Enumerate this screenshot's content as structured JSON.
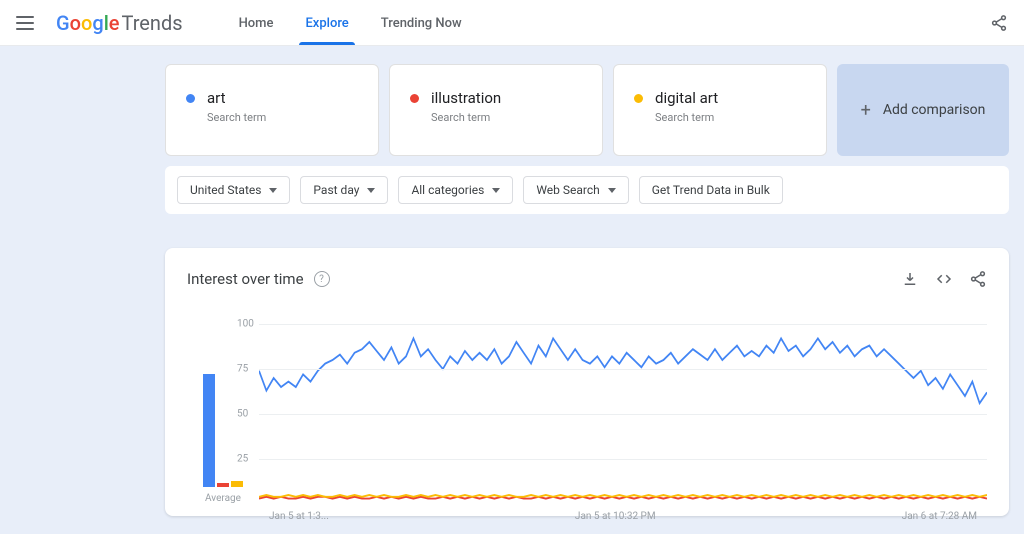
{
  "header": {
    "logo_google": "Google",
    "logo_trends": "Trends",
    "nav": [
      {
        "label": "Home",
        "active": false
      },
      {
        "label": "Explore",
        "active": true
      },
      {
        "label": "Trending Now",
        "active": false
      }
    ]
  },
  "terms": [
    {
      "name": "art",
      "sub": "Search term",
      "color": "#4285F4"
    },
    {
      "name": "illustration",
      "sub": "Search term",
      "color": "#EA4335"
    },
    {
      "name": "digital art",
      "sub": "Search term",
      "color": "#FBBC05"
    }
  ],
  "add_compare_label": "Add comparison",
  "filters": {
    "geo": "United States",
    "time": "Past day",
    "category": "All categories",
    "search_type": "Web Search",
    "bulk": "Get Trend Data in Bulk"
  },
  "chart": {
    "title": "Interest over time",
    "avg_label": "Average",
    "x_labels": [
      "Jan 5 at 1:3...",
      "Jan 5 at 10:32 PM",
      "Jan 6 at 7:28 AM"
    ]
  },
  "chart_data": {
    "type": "line",
    "ylabel": "",
    "ylim": [
      0,
      100
    ],
    "yticks": [
      25,
      50,
      75,
      100
    ],
    "x_labels": [
      "Jan 5 at 1:3...",
      "Jan 5 at 10:32 PM",
      "Jan 6 at 7:28 AM"
    ],
    "averages": {
      "art": 81,
      "illustration": 3,
      "digital art": 4
    },
    "series": [
      {
        "name": "art",
        "color": "#4285F4",
        "values": [
          74,
          63,
          70,
          65,
          68,
          65,
          72,
          68,
          74,
          78,
          80,
          83,
          78,
          84,
          86,
          90,
          85,
          80,
          87,
          78,
          82,
          92,
          82,
          86,
          80,
          75,
          82,
          78,
          85,
          80,
          84,
          80,
          86,
          78,
          82,
          90,
          84,
          78,
          88,
          82,
          92,
          86,
          80,
          86,
          80,
          78,
          82,
          76,
          82,
          78,
          84,
          80,
          76,
          82,
          78,
          80,
          84,
          78,
          82,
          86,
          83,
          80,
          86,
          80,
          84,
          88,
          82,
          85,
          82,
          88,
          84,
          92,
          85,
          88,
          82,
          86,
          92,
          86,
          90,
          84,
          88,
          82,
          86,
          88,
          82,
          86,
          82,
          78,
          74,
          70,
          74,
          66,
          70,
          64,
          72,
          66,
          60,
          68,
          56,
          62
        ]
      },
      {
        "name": "illustration",
        "color": "#EA4335",
        "values": [
          3,
          4,
          3,
          4,
          3,
          3,
          4,
          3,
          4,
          4,
          3,
          4,
          3,
          4,
          3,
          3,
          4,
          3,
          4,
          3,
          4,
          3,
          4,
          3,
          3,
          4,
          3,
          4,
          3,
          4,
          3,
          4,
          3,
          4,
          3,
          4,
          3,
          3,
          4,
          3,
          4,
          3,
          4,
          3,
          4,
          3,
          4,
          3,
          4,
          3,
          4,
          3,
          4,
          3,
          4,
          3,
          4,
          3,
          4,
          3,
          4,
          3,
          4,
          3,
          4,
          3,
          4,
          3,
          4,
          3,
          4,
          3,
          4,
          3,
          4,
          3,
          4,
          3,
          4,
          3,
          4,
          3,
          4,
          3,
          4,
          3,
          4,
          3,
          4,
          3,
          4,
          3,
          4,
          3,
          4,
          3,
          4,
          3,
          4,
          3
        ]
      },
      {
        "name": "digital art",
        "color": "#FBBC05",
        "values": [
          4,
          5,
          4,
          4,
          5,
          4,
          5,
          4,
          5,
          4,
          4,
          5,
          4,
          5,
          4,
          5,
          4,
          5,
          4,
          4,
          5,
          4,
          5,
          4,
          5,
          4,
          5,
          4,
          5,
          4,
          5,
          4,
          5,
          4,
          5,
          4,
          4,
          5,
          4,
          5,
          4,
          5,
          4,
          5,
          4,
          5,
          4,
          5,
          4,
          5,
          4,
          5,
          4,
          5,
          4,
          5,
          4,
          5,
          4,
          5,
          4,
          5,
          4,
          5,
          4,
          5,
          4,
          5,
          4,
          5,
          4,
          5,
          4,
          5,
          4,
          5,
          4,
          5,
          4,
          5,
          4,
          5,
          4,
          5,
          4,
          5,
          4,
          5,
          4,
          5,
          4,
          5,
          4,
          5,
          4,
          5,
          4,
          5,
          4,
          5
        ]
      }
    ]
  }
}
